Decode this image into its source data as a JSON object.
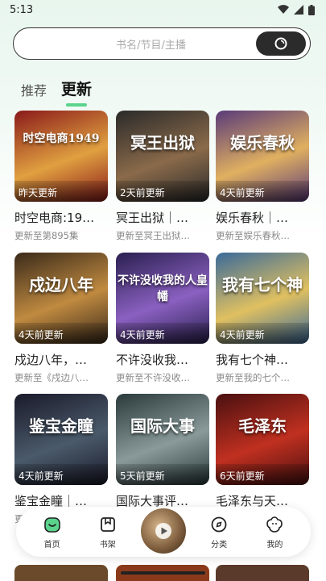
{
  "status": {
    "time": "5:13"
  },
  "search": {
    "placeholder": "书名/节目/主播"
  },
  "tabs": [
    {
      "label": "推荐",
      "active": false
    },
    {
      "label": "更新",
      "active": true
    }
  ],
  "books": [
    {
      "cover_text": "时空电商1949",
      "badge": "昨天更新",
      "title": "时空电商:19…",
      "subtitle": "更新至第895集",
      "colors": [
        "#8a1a1a",
        "#e0a040"
      ]
    },
    {
      "cover_text": "冥王出狱",
      "badge": "2天前更新",
      "title": "冥王出狱｜…",
      "subtitle": "更新至冥王出狱…",
      "colors": [
        "#2a2a2a",
        "#8a6a4a"
      ]
    },
    {
      "cover_text": "娱乐春秋",
      "badge": "4天前更新",
      "title": "娱乐春秋｜…",
      "subtitle": "更新至娱乐春秋…",
      "colors": [
        "#5a3a7a",
        "#e0b060"
      ]
    },
    {
      "cover_text": "戍边八年",
      "badge": "4天前更新",
      "title": "戍边八年，…",
      "subtitle": "更新至《戍边八…",
      "colors": [
        "#3a2a1a",
        "#c08a40"
      ]
    },
    {
      "cover_text": "不许没收我的人皇幡",
      "badge": "4天前更新",
      "title": "不许没收我…",
      "subtitle": "更新至不许没收…",
      "colors": [
        "#2a2050",
        "#8a60c0"
      ]
    },
    {
      "cover_text": "我有七个神",
      "badge": "4天前更新",
      "title": "我有七个神…",
      "subtitle": "更新至我的七个…",
      "colors": [
        "#3a6a9a",
        "#e0c060"
      ]
    },
    {
      "cover_text": "鉴宝金瞳",
      "badge": "4天前更新",
      "title": "鉴宝金瞳｜…",
      "subtitle": "更",
      "colors": [
        "#1a1a2a",
        "#4a5a6a"
      ]
    },
    {
      "cover_text": "国际大事",
      "badge": "5天前更新",
      "title": "国际大事评…",
      "subtitle": "",
      "colors": [
        "#2a3a3a",
        "#8a9a9a"
      ]
    },
    {
      "cover_text": "毛泽东",
      "badge": "6天前更新",
      "title": "毛泽东与天…",
      "subtitle": "",
      "colors": [
        "#4a1010",
        "#c03020"
      ]
    }
  ],
  "nav": [
    {
      "label": "首页",
      "icon": "home-icon",
      "active": true
    },
    {
      "label": "书架",
      "icon": "bookshelf-icon",
      "active": false
    },
    {
      "label": "分类",
      "icon": "category-icon",
      "active": false
    },
    {
      "label": "我的",
      "icon": "profile-icon",
      "active": false
    }
  ],
  "accent": "#5ad48c"
}
